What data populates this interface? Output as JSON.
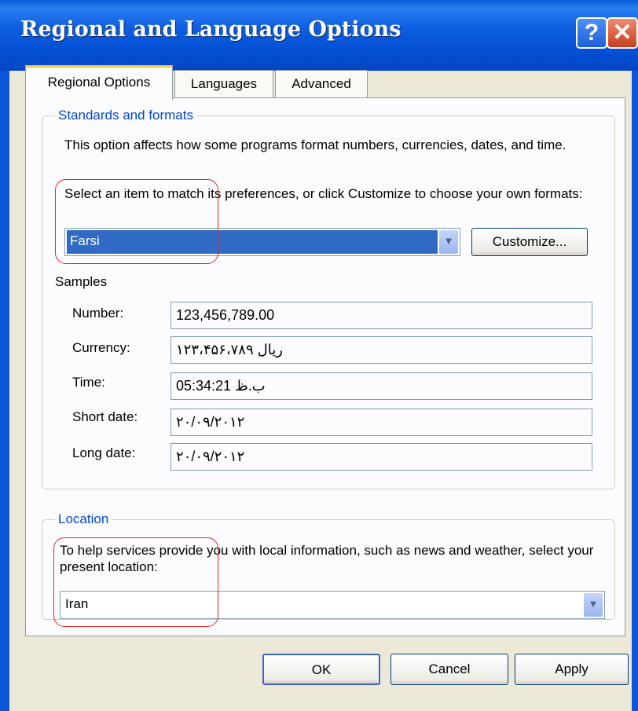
{
  "window": {
    "title": "Regional and Language Options"
  },
  "titlebar": {
    "help_glyph": "?",
    "close_glyph": "✕"
  },
  "tabs": [
    {
      "label": "Regional Options",
      "active": true
    },
    {
      "label": "Languages",
      "active": false
    },
    {
      "label": "Advanced",
      "active": false
    }
  ],
  "standards": {
    "legend": "Standards and formats",
    "description": "This option affects how some programs format numbers, currencies, dates, and time.",
    "instruction": "Select an item to match its preferences, or click Customize to choose your own formats:",
    "selected_format": "Farsi",
    "customize_label": "Customize...",
    "samples_heading": "Samples",
    "samples": [
      {
        "label": "Number:",
        "value": "123,456,789.00"
      },
      {
        "label": "Currency:",
        "value": "ریال ۱۲۳،۴۵۶،۷۸۹"
      },
      {
        "label": "Time:",
        "value": "ب.ظ 05:34:21"
      },
      {
        "label": "Short date:",
        "value": "۲۰/۰۹/۲۰۱۲"
      },
      {
        "label": "Long date:",
        "value": "۲۰/۰۹/۲۰۱۲"
      }
    ]
  },
  "location": {
    "legend": "Location",
    "description": "To help services provide you with local information, such as news and weather, select your present location:",
    "selected_location": "Iran"
  },
  "footer": {
    "ok_label": "OK",
    "cancel_label": "Cancel",
    "apply_label": "Apply"
  },
  "icons": {
    "dropdown_arrow": "chevron-down-icon"
  },
  "colors": {
    "titlebar": "#0450d6",
    "legend": "#0046d5",
    "selection": "#316ac5",
    "annotation": "#e32626"
  }
}
